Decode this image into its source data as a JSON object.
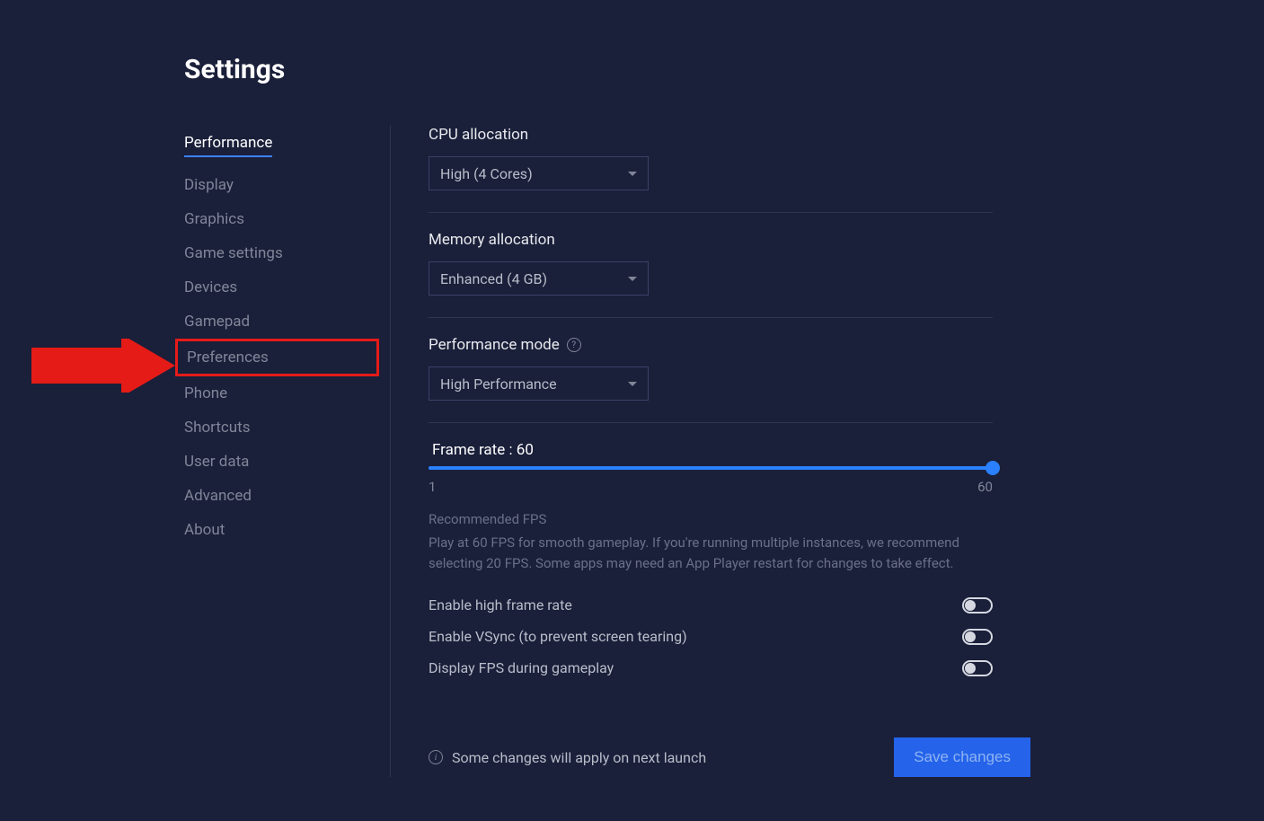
{
  "title": "Settings",
  "sidebar": {
    "items": [
      {
        "label": "Performance",
        "active": true
      },
      {
        "label": "Display"
      },
      {
        "label": "Graphics"
      },
      {
        "label": "Game settings"
      },
      {
        "label": "Devices"
      },
      {
        "label": "Gamepad"
      },
      {
        "label": "Preferences",
        "highlighted": true
      },
      {
        "label": "Phone"
      },
      {
        "label": "Shortcuts"
      },
      {
        "label": "User data"
      },
      {
        "label": "Advanced"
      },
      {
        "label": "About"
      }
    ]
  },
  "cpu": {
    "label": "CPU allocation",
    "value": "High (4 Cores)"
  },
  "memory": {
    "label": "Memory allocation",
    "value": "Enhanced (4 GB)"
  },
  "perfmode": {
    "label": "Performance mode",
    "value": "High Performance"
  },
  "framerate": {
    "label": "Frame rate : 60",
    "min": "1",
    "max": "60",
    "value": 60
  },
  "recommended": {
    "title": "Recommended FPS",
    "text": "Play at 60 FPS for smooth gameplay. If you're running multiple instances, we recommend selecting 20 FPS. Some apps may need an App Player restart for changes to take effect."
  },
  "toggles": {
    "high_fps": "Enable high frame rate",
    "vsync": "Enable VSync (to prevent screen tearing)",
    "display_fps": "Display FPS during gameplay"
  },
  "footer": {
    "note": "Some changes will apply on next launch",
    "save": "Save changes"
  }
}
